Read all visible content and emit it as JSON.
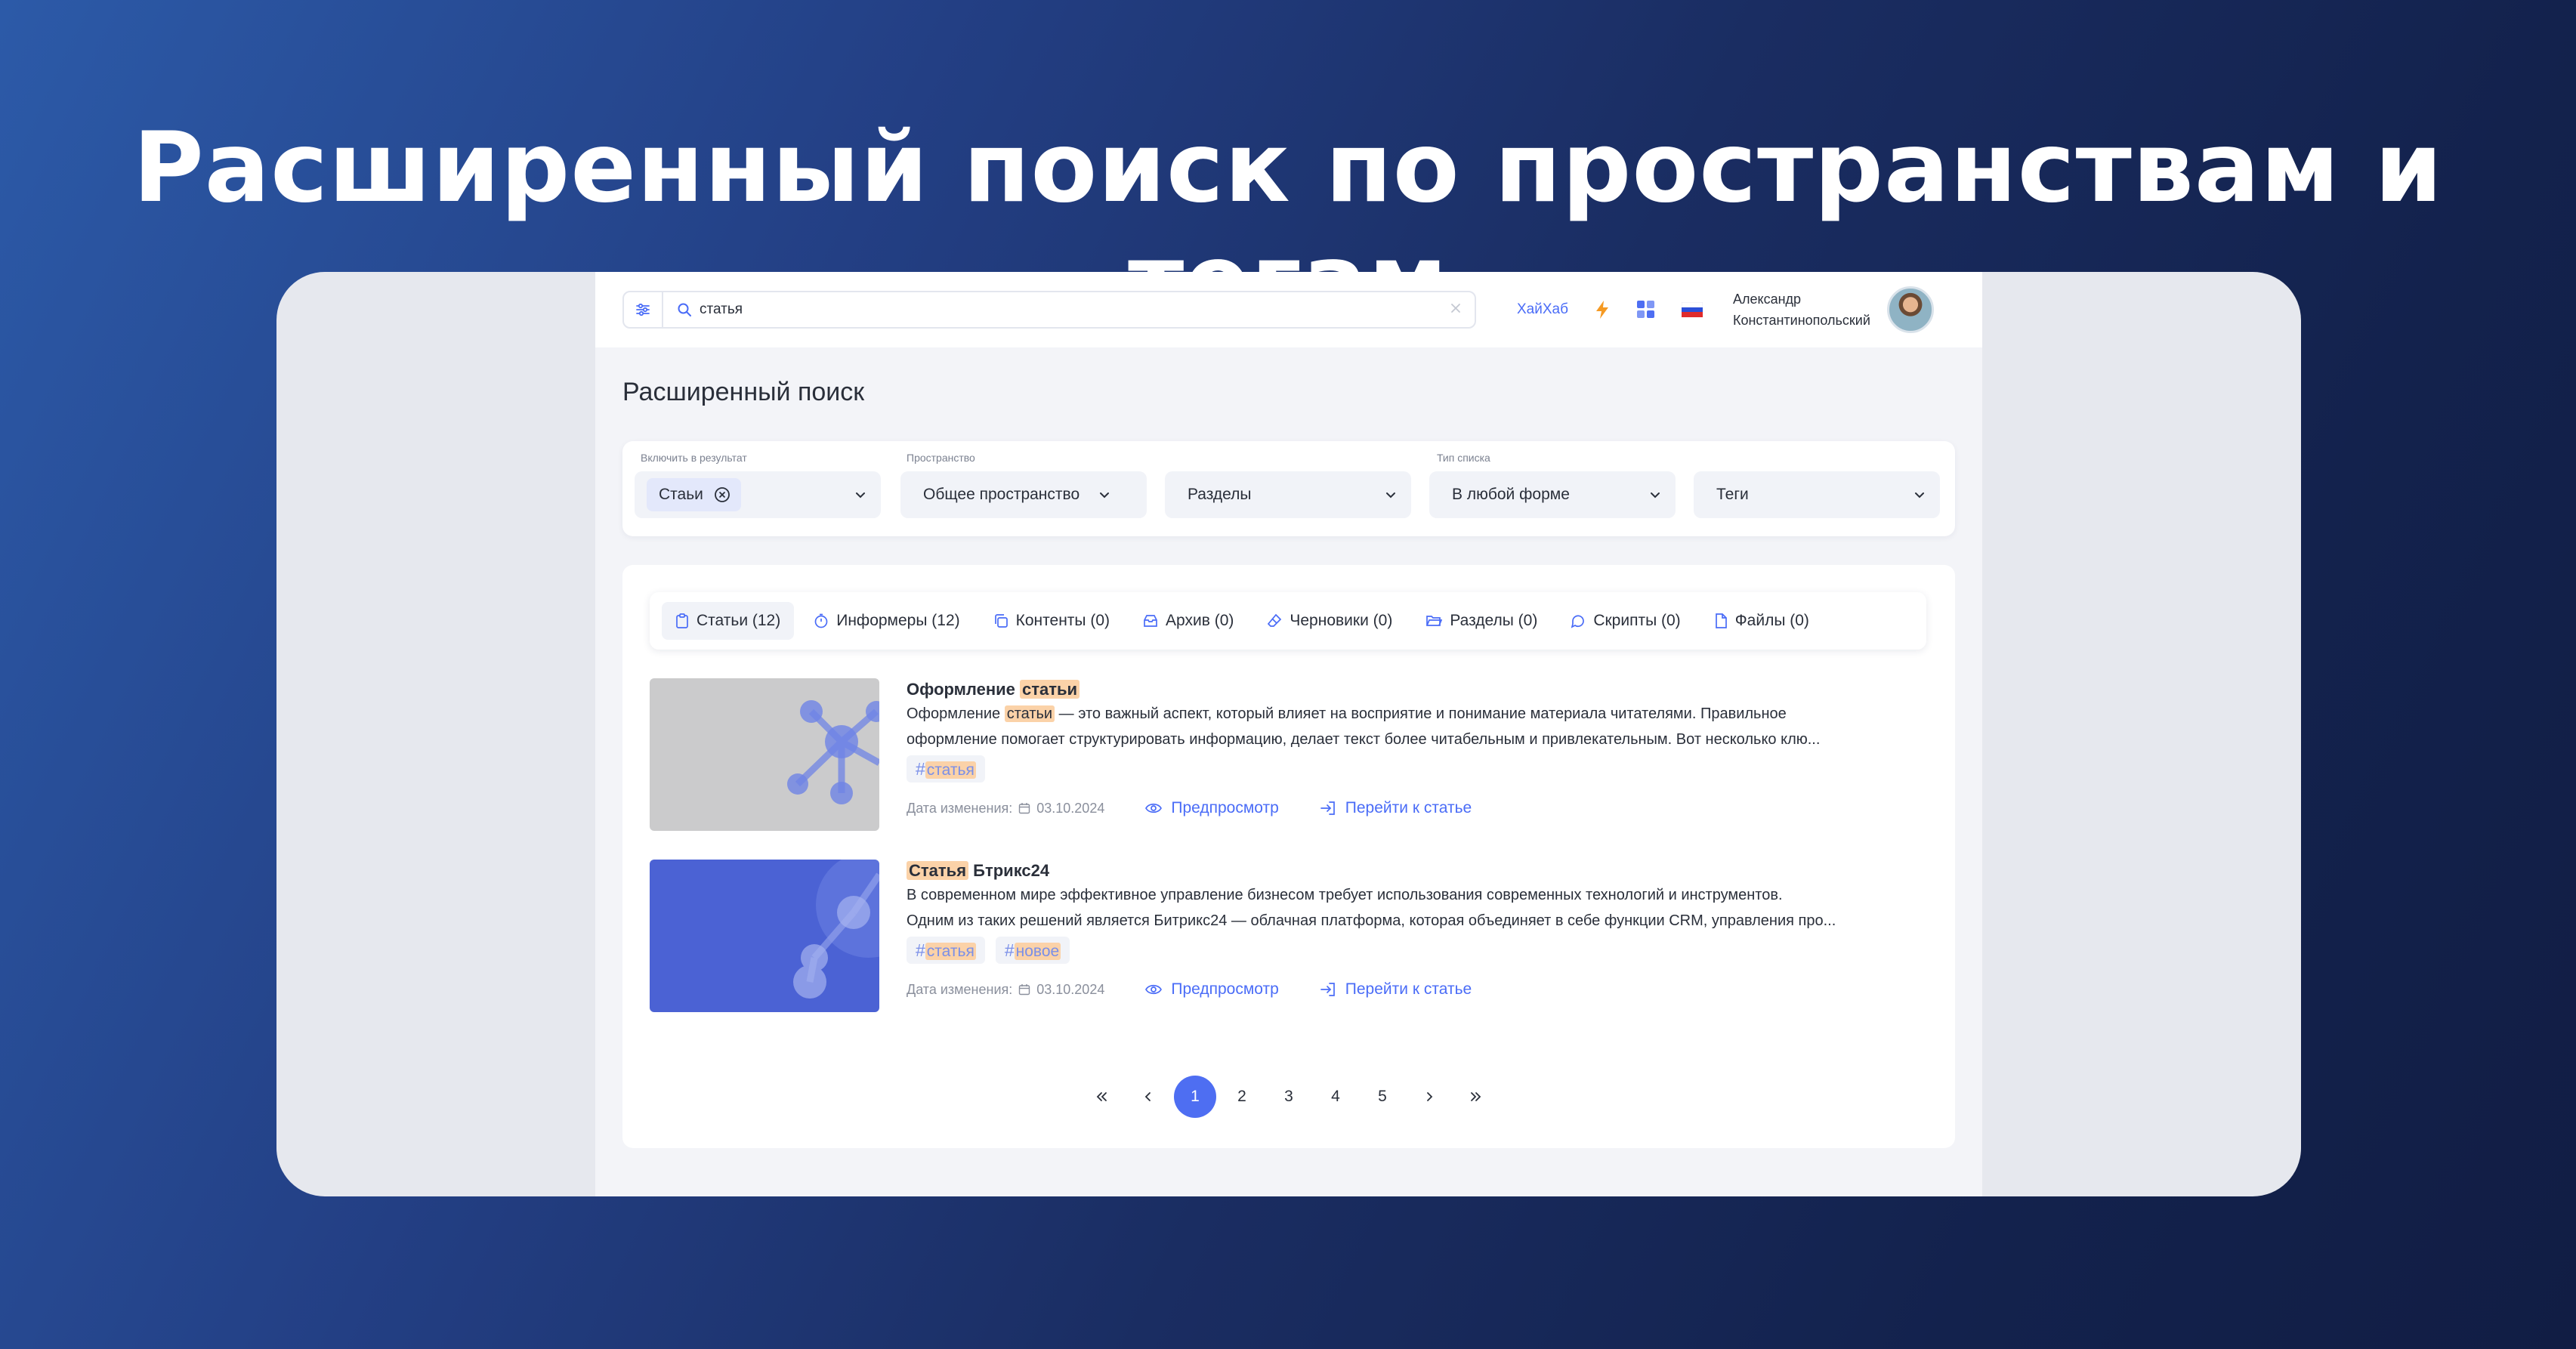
{
  "hero": {
    "title": "Расширенный поиск по пространствам и тегам"
  },
  "topbar": {
    "search_value": "статья",
    "hub_link": "ХайХаб",
    "user_first": "Александр",
    "user_last": "Константинопольский",
    "icons": [
      "settings-sliders-icon",
      "search-icon",
      "clear-icon",
      "lightning-icon",
      "apps-grid-icon",
      "russia-flag-icon"
    ]
  },
  "page": {
    "title": "Расширенный поиск"
  },
  "filters": {
    "include_label": "Включить в результат",
    "include_chip": "Стаьи",
    "space_label": "Пространство",
    "space_value": "Общее пространство",
    "sections_value": "Разделы",
    "list_type_label": "Тип списка",
    "list_type_value": "В любой форме",
    "tags_value": "Теги"
  },
  "tabs": [
    {
      "label": "Статьи (12)",
      "icon": "clipboard-icon",
      "active": true
    },
    {
      "label": "Информеры (12)",
      "icon": "stopwatch-icon",
      "active": false
    },
    {
      "label": "Контенты (0)",
      "icon": "copy-icon",
      "active": false
    },
    {
      "label": "Архив (0)",
      "icon": "archive-icon",
      "active": false
    },
    {
      "label": "Черновики (0)",
      "icon": "eraser-icon",
      "active": false
    },
    {
      "label": "Разделы (0)",
      "icon": "folder-icon",
      "active": false
    },
    {
      "label": "Скрипты (0)",
      "icon": "chat-icon",
      "active": false
    },
    {
      "label": "Файлы (0)",
      "icon": "file-icon",
      "active": false
    }
  ],
  "results": [
    {
      "title_pre": "Оформление ",
      "title_hl": "статьи",
      "title_post": "",
      "text1_pre": "Оформление ",
      "text1_hl": "статьи",
      "text1_post": " — это важный аспект, который влияет на восприятие и понимание материала читателями. Правильное",
      "text2": "оформление помогает структурировать информацию, делает текст более читабельным и привлекательным. Вот несколько клю...",
      "tags": [
        "статья"
      ],
      "date_label": "Дата изменения:",
      "date": "03.10.2024",
      "preview": "Предпросмотр",
      "goto": "Перейти к статье"
    },
    {
      "title_pre": "",
      "title_hl": "Статья",
      "title_post": " Бтрикс24",
      "text1_pre": "В современном мире эффективное управление бизнесом требует использования современных технологий и инструментов.",
      "text1_hl": "",
      "text1_post": "",
      "text2": "Одним из таких решений является Битрикс24 — облачная платформа, которая объединяет в себе функции CRM, управления про...",
      "tags": [
        "статья",
        "новое"
      ],
      "date_label": "Дата изменения:",
      "date": "03.10.2024",
      "preview": "Предпросмотр",
      "goto": "Перейти к статье"
    }
  ],
  "pagination": {
    "pages": [
      "1",
      "2",
      "3",
      "4",
      "5"
    ],
    "current": "1"
  },
  "colors": {
    "accent": "#4e6ef2",
    "highlight": "#fbd2a8",
    "link": "#4a6cf7"
  }
}
